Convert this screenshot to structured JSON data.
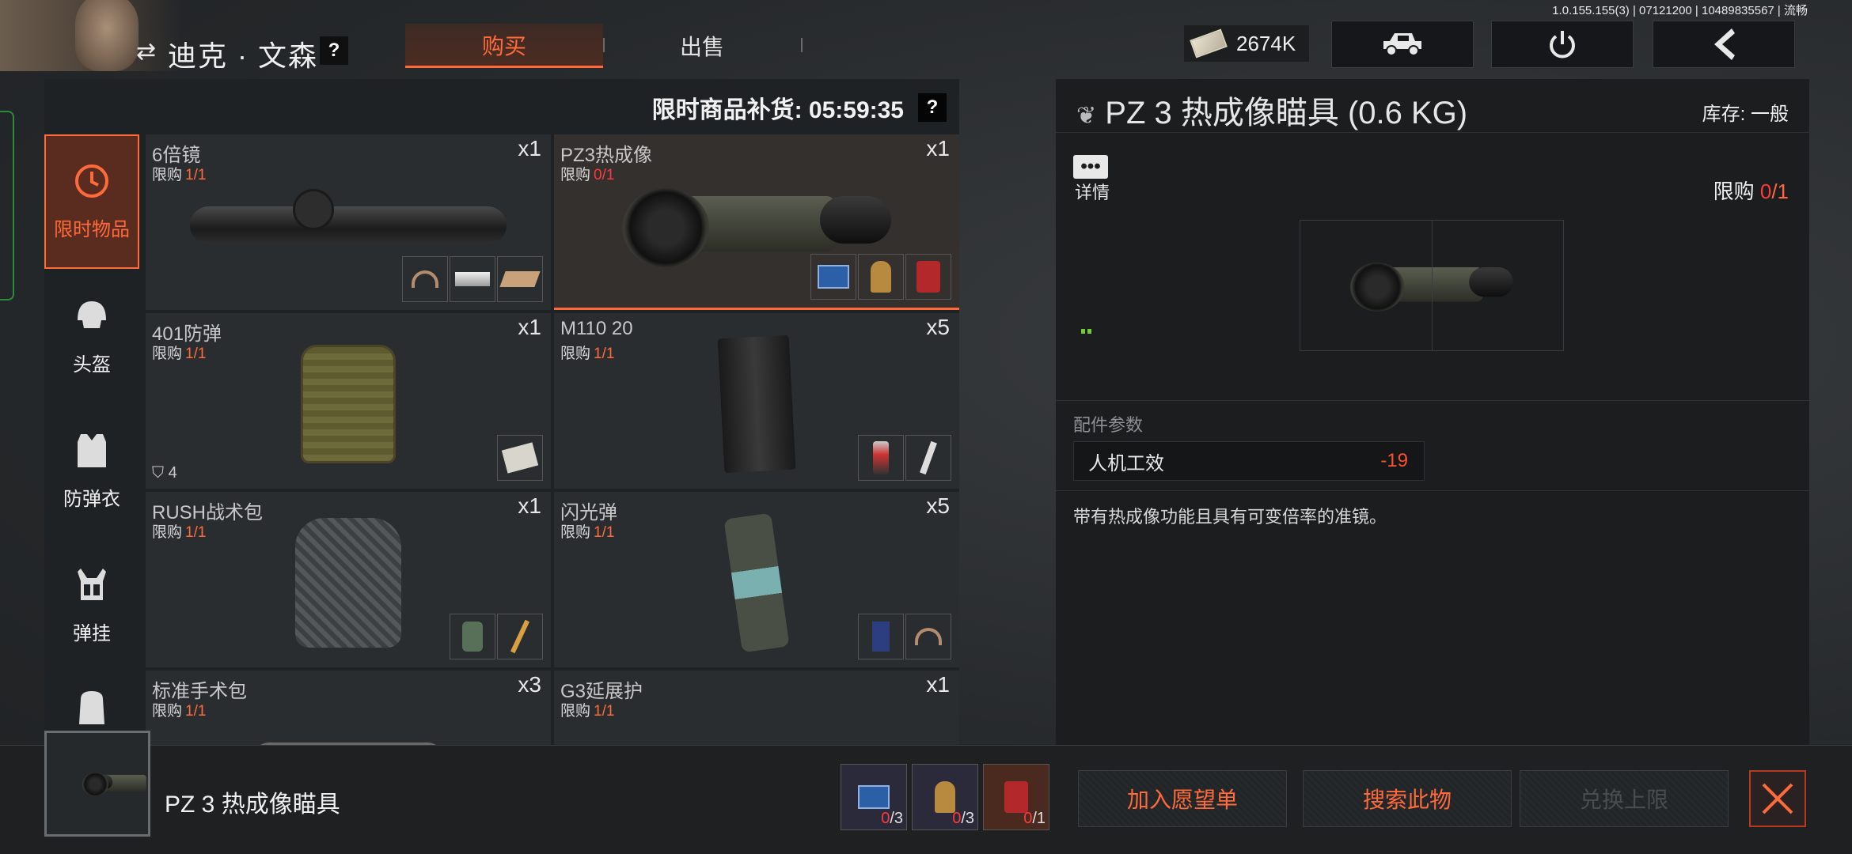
{
  "app": {
    "version_text": "1.0.155.155(3) | 07121200 | 10489835567 | 流畅"
  },
  "header": {
    "character_name": "迪克 · 文森",
    "swap_icon": "swap-arrows-icon",
    "help_label": "?",
    "tabs": [
      {
        "label": "购买",
        "active": true
      },
      {
        "label": "出售",
        "active": false
      }
    ],
    "currency": {
      "icon": "cash-icon",
      "amount": "2674K"
    },
    "buttons": [
      {
        "icon": "vehicle-icon"
      },
      {
        "icon": "power-icon"
      },
      {
        "icon": "back-arrow-icon"
      }
    ]
  },
  "shop": {
    "restock_text": "限时商品补货: 05:59:35",
    "restock_help": "?",
    "categories": [
      {
        "label": "限时物品",
        "icon": "clock-icon",
        "active": true
      },
      {
        "label": "头盔",
        "icon": "helmet-icon",
        "active": false
      },
      {
        "label": "防弹衣",
        "icon": "vest-icon",
        "active": false
      },
      {
        "label": "弹挂",
        "icon": "chest-rig-icon",
        "active": false
      },
      {
        "label": "",
        "icon": "backpack-icon",
        "active": false
      }
    ],
    "items": [
      {
        "name": "6倍镜",
        "limit_label": "限购",
        "limit_value": "1/1",
        "qty": "x1",
        "reqs": [
          "hook",
          "box",
          "wood"
        ]
      },
      {
        "name": "PZ3热成像",
        "limit_label": "限购",
        "limit_value": "0/1",
        "qty": "x1",
        "selected": true,
        "reqs": [
          "board",
          "clock",
          "can"
        ]
      },
      {
        "name": "401防弹",
        "limit_label": "限购",
        "limit_value": "1/1",
        "qty": "x1",
        "armor": "4",
        "reqs": [
          "paper"
        ]
      },
      {
        "name": "M110 20",
        "limit_label": "限购",
        "limit_value": "1/1",
        "qty": "x5",
        "reqs": [
          "spray",
          "screw"
        ]
      },
      {
        "name": "RUSH战术包",
        "limit_label": "限购",
        "limit_value": "1/1",
        "qty": "x1",
        "reqs": [
          "lamp",
          "pencil"
        ]
      },
      {
        "name": "闪光弹",
        "limit_label": "限购",
        "limit_value": "1/1",
        "qty": "x5",
        "reqs": [
          "blue",
          "hook"
        ]
      },
      {
        "name": "标准手术包",
        "limit_label": "限购",
        "limit_value": "1/1",
        "qty": "x3",
        "reqs": []
      },
      {
        "name": "G3延展护",
        "limit_label": "限购",
        "limit_value": "1/1",
        "qty": "x1",
        "reqs": []
      }
    ]
  },
  "detail": {
    "title": "PZ 3 热成像瞄具 (0.6 KG)",
    "stock": "库存: 一般",
    "info_label": "详情",
    "limit_label": "限购",
    "limit_current": "0",
    "limit_total": "/1",
    "params_title": "配件参数",
    "params": [
      {
        "name": "人机工效",
        "value": "-19"
      }
    ],
    "description": "带有热成像功能且具有可变倍率的准镜。"
  },
  "bottom": {
    "selected_name": "PZ 3 热成像瞄具",
    "requirements": [
      {
        "icon": "circuit-board-icon",
        "have": "0",
        "need": "/3"
      },
      {
        "icon": "antique-clock-icon",
        "have": "0",
        "need": "/3"
      },
      {
        "icon": "fuel-can-icon",
        "have": "0",
        "need": "/1"
      }
    ],
    "wishlist_label": "加入愿望单",
    "search_label": "搜索此物",
    "exchange_label": "兑换上限",
    "close_icon": "close-icon"
  },
  "colors": {
    "accent": "#ff6a3a",
    "limit_red": "#ff3a3a",
    "panel": "#1f2224"
  }
}
